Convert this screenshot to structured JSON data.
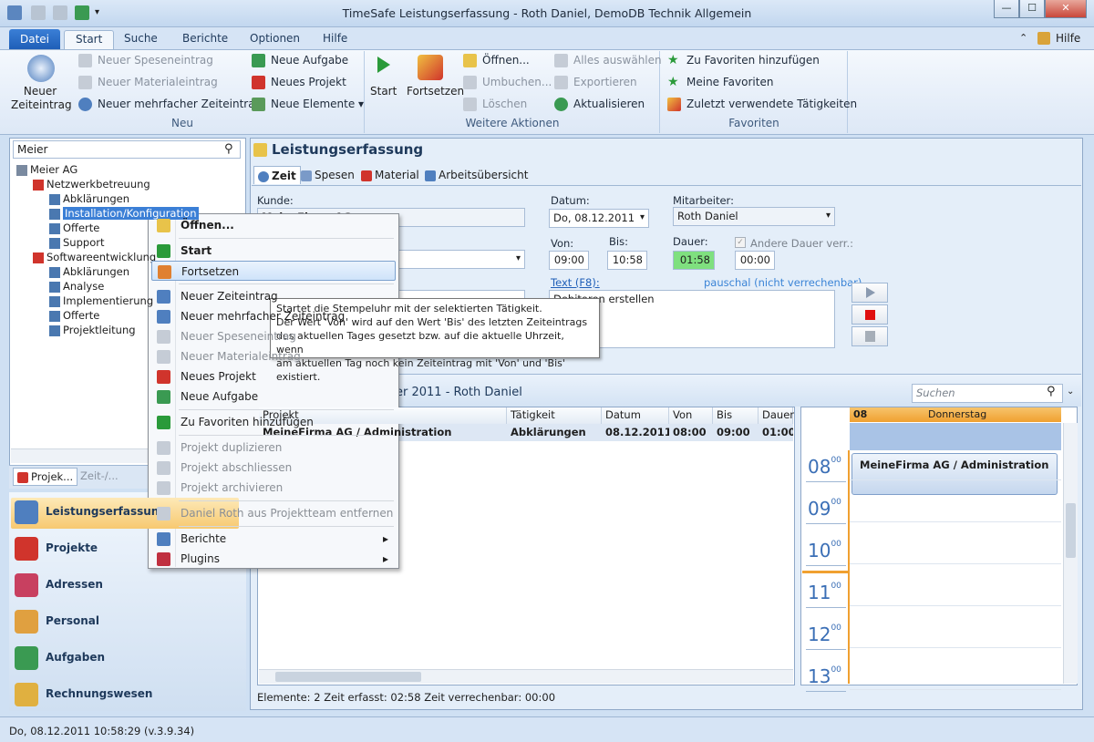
{
  "window": {
    "title": "TimeSafe Leistungserfassung - Roth Daniel, DemoDB Technik Allgemein"
  },
  "ribbon": {
    "tabs": [
      "Datei",
      "Start",
      "Suche",
      "Berichte",
      "Optionen",
      "Hilfe"
    ],
    "help": "Hilfe",
    "neu": {
      "big": "Neuer\nZeiteintrag",
      "items": [
        "Neuer Speseneintrag",
        "Neuer Materialeintrag",
        "Neuer mehrfacher Zeiteintrag",
        "Neue Aufgabe",
        "Neues Projekt",
        "Neue Elemente"
      ],
      "label": "Neu"
    },
    "weitere": {
      "start": "Start",
      "fortsetzen": "Fortsetzen",
      "items": [
        "Öffnen...",
        "Umbuchen...",
        "Löschen",
        "Alles auswählen",
        "Exportieren",
        "Aktualisieren"
      ],
      "label": "Weitere Aktionen"
    },
    "favoriten": {
      "items": [
        "Zu Favoriten hinzufügen",
        "Meine Favoriten",
        "Zuletzt verwendete Tätigkeiten"
      ],
      "label": "Favoriten"
    }
  },
  "left": {
    "search": "Meier",
    "tree": [
      {
        "t": "Meier AG",
        "lvl": 0
      },
      {
        "t": "Netzwerkbetreuung",
        "lvl": 1
      },
      {
        "t": "Abklärungen",
        "lvl": 2
      },
      {
        "t": "Installation/Konfiguration",
        "lvl": 2,
        "sel": true
      },
      {
        "t": "Offerte",
        "lvl": 2
      },
      {
        "t": "Support",
        "lvl": 2
      },
      {
        "t": "Softwareentwicklung",
        "lvl": 1
      },
      {
        "t": "Abklärungen",
        "lvl": 2
      },
      {
        "t": "Analyse",
        "lvl": 2
      },
      {
        "t": "Implementierung",
        "lvl": 2
      },
      {
        "t": "Offerte",
        "lvl": 2
      },
      {
        "t": "Projektleitung",
        "lvl": 2
      }
    ],
    "tabs": [
      "Projek...",
      "Zeit-/..."
    ],
    "nav": [
      "Leistungserfassung",
      "Projekte",
      "Adressen",
      "Personal",
      "Aufgaben",
      "Rechnungswesen"
    ]
  },
  "main": {
    "header": "Leistungserfassung",
    "tabs": [
      "Zeit",
      "Spesen",
      "Material",
      "Arbeitsübersicht"
    ],
    "kunde_label": "Kunde:",
    "kunde_value": "MeineFirma AG",
    "datum_label": "Datum:",
    "datum": "Do, 08.12.2011",
    "mitarbeiter_label": "Mitarbeiter:",
    "mitarbeiter": "Roth Daniel",
    "von_label": "Von:",
    "von": "09:00",
    "bis_label": "Bis:",
    "bis": "10:58",
    "dauer_label": "Dauer:",
    "dauer": "01:58",
    "andere_label": "Andere Dauer verr.:",
    "andere": "00:00",
    "text_label": "Text (F8):",
    "pauschal": "pauschal (nicht verrechenbar)",
    "text": "Debitoren erstellen",
    "list_title": "Zeiteinträge Dezember 2011 - Roth Daniel",
    "search_placeholder": "Suchen",
    "columns": [
      "Projekt",
      "Tätigkeit",
      "Datum",
      "Von",
      "Bis",
      "Dauer"
    ],
    "row": [
      "MeineFirma AG / Administration",
      "Abklärungen",
      "08.12.2011",
      "08:00",
      "09:00",
      "01:00"
    ],
    "status": "Elemente: 2   Zeit erfasst: 02:58   Zeit verrechenbar: 00:00"
  },
  "calendar": {
    "day_num": "08",
    "day_name": "Donnerstag",
    "hours": [
      "08",
      "09",
      "10",
      "11",
      "12",
      "13"
    ],
    "minutes": "00",
    "event": "MeineFirma AG / Administration"
  },
  "context_menu": {
    "items": [
      {
        "t": "Öffnen...",
        "bold": true
      },
      {
        "t": "Start",
        "bold": true
      },
      {
        "t": "Fortsetzen",
        "hl": true
      },
      {
        "t": "Neuer Zeiteintrag"
      },
      {
        "t": "Neuer mehrfacher Zeiteintrag"
      },
      {
        "t": "Neuer Speseneintrag",
        "dis": true
      },
      {
        "t": "Neuer Materialeintrag",
        "dis": true
      },
      {
        "t": "Neues Projekt"
      },
      {
        "t": "Neue Aufgabe"
      },
      {
        "t": "Zu Favoriten hinzufügen"
      },
      {
        "t": "Projekt duplizieren",
        "dis": true
      },
      {
        "t": "Projekt abschliessen",
        "dis": true
      },
      {
        "t": "Projekt archivieren",
        "dis": true
      },
      {
        "t": "Daniel Roth aus Projektteam entfernen",
        "dis": true
      },
      {
        "t": "Berichte",
        "sub": true
      },
      {
        "t": "Plugins",
        "sub": true
      }
    ]
  },
  "tooltip": {
    "lines": [
      "Startet die Stempeluhr mit der selektierten Tätigkeit.",
      "Der Wert 'Von' wird auf den Wert 'Bis' des letzten Zeiteintrags",
      "des aktuellen Tages gesetzt bzw. auf die aktuelle Uhrzeit, wenn",
      "am aktuellen Tag noch kein Zeiteintrag mit 'Von' und 'Bis' existiert."
    ]
  },
  "statusbar": "Do, 08.12.2011 10:58:29 (v.3.9.34)"
}
